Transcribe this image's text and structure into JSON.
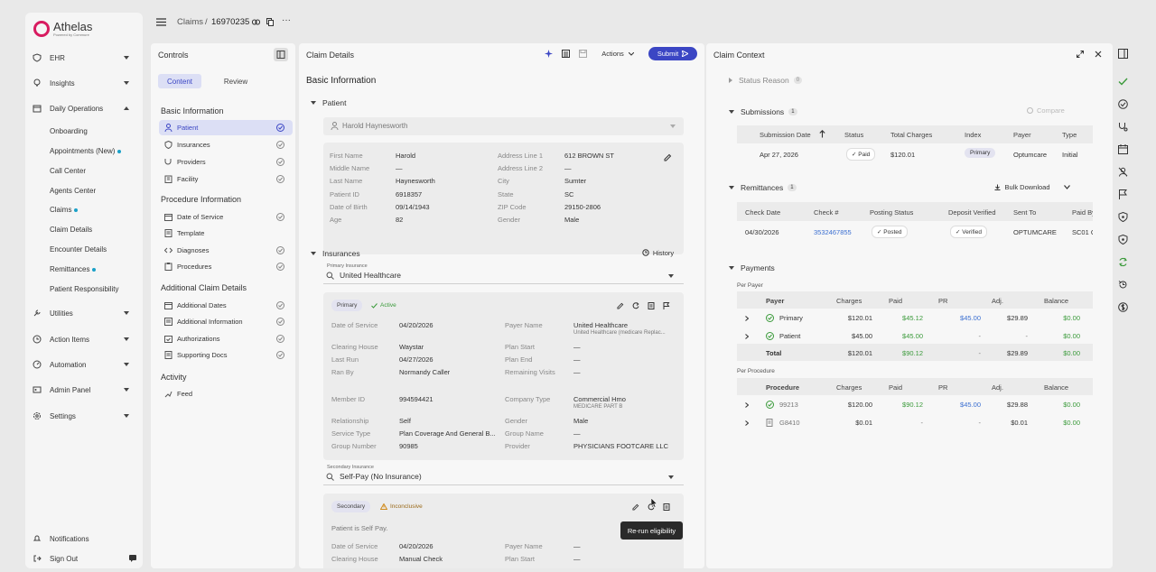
{
  "app": {
    "name": "Athelas",
    "tagline": "Powered by Commure"
  },
  "sidebar": {
    "items": [
      {
        "label": "EHR"
      },
      {
        "label": "Insights"
      },
      {
        "label": "Daily Operations"
      },
      {
        "label": "Utilities"
      },
      {
        "label": "Action Items"
      },
      {
        "label": "Automation"
      },
      {
        "label": "Admin Panel"
      },
      {
        "label": "Settings"
      }
    ],
    "sub_items": [
      {
        "label": "Onboarding"
      },
      {
        "label": "Appointments (New)"
      },
      {
        "label": "Call Center"
      },
      {
        "label": "Agents Center"
      },
      {
        "label": "Claims"
      },
      {
        "label": "Claim Details"
      },
      {
        "label": "Encounter Details"
      },
      {
        "label": "Remittances"
      },
      {
        "label": "Patient Responsibility"
      }
    ],
    "notifications": "Notifications",
    "sign_out": "Sign Out"
  },
  "header": {
    "section": "Claims",
    "separator": "/",
    "claim_id": "16970235",
    "more": "···"
  },
  "controls": {
    "title": "Controls",
    "tabs": [
      "Content",
      "Review"
    ],
    "groups": [
      {
        "heading": "Basic Information",
        "items": [
          "Patient",
          "Insurances",
          "Providers",
          "Facility"
        ]
      },
      {
        "heading": "Procedure Information",
        "items": [
          "Date of Service",
          "Template",
          "Diagnoses",
          "Procedures"
        ]
      },
      {
        "heading": "Additional Claim Details",
        "items": [
          "Additional Dates",
          "Additional Information",
          "Authorizations",
          "Supporting Docs"
        ]
      },
      {
        "heading": "Activity",
        "items": [
          "Feed"
        ]
      }
    ]
  },
  "claim_details": {
    "title": "Claim Details",
    "actions_label": "Actions",
    "submit_label": "Submit",
    "basic_info_title": "Basic Information",
    "patient_section": "Patient",
    "patient_select": "Harold Haynesworth",
    "patient_fields": [
      {
        "label": "First Name",
        "value": "Harold"
      },
      {
        "label": "Middle Name",
        "value": "—"
      },
      {
        "label": "Last Name",
        "value": "Haynesworth"
      },
      {
        "label": "Patient ID",
        "value": "6918357"
      },
      {
        "label": "Date of Birth",
        "value": "09/14/1943"
      },
      {
        "label": "Age",
        "value": "82"
      }
    ],
    "address_fields": [
      {
        "label": "Address Line 1",
        "value": "612 BROWN ST"
      },
      {
        "label": "Address Line 2",
        "value": "—"
      },
      {
        "label": "City",
        "value": "Sumter"
      },
      {
        "label": "State",
        "value": "SC"
      },
      {
        "label": "ZIP Code",
        "value": "29150-2806"
      },
      {
        "label": "Gender",
        "value": "Male"
      }
    ],
    "insurances_section": "Insurances",
    "history_label": "History",
    "primary_insurance_label": "Primary Insurance",
    "primary_insurance_value": "United Healthcare",
    "primary_badge": "Primary",
    "active_badge": "Active",
    "primary_left": [
      {
        "label": "Date of Service",
        "value": "04/20/2026"
      },
      {
        "label": "Clearing House",
        "value": "Waystar"
      },
      {
        "label": "Last Run",
        "value": "04/27/2026"
      },
      {
        "label": "Ran By",
        "value": "Normandy Caller"
      },
      {
        "label": "Member ID",
        "value": "994594421"
      },
      {
        "label": "Relationship",
        "value": "Self"
      },
      {
        "label": "Service Type",
        "value": "Plan Coverage And General B..."
      },
      {
        "label": "Group Number",
        "value": "90985"
      }
    ],
    "primary_right": [
      {
        "label": "Payer Name",
        "value": "United Healthcare",
        "sub": "United Healthcare (medicare Replac..."
      },
      {
        "label": "Plan Start",
        "value": "—"
      },
      {
        "label": "Plan End",
        "value": "—"
      },
      {
        "label": "Remaining Visits",
        "value": "—"
      },
      {
        "label": "Company Type",
        "value": "Commercial Hmo",
        "sub": "MEDICARE PART B"
      },
      {
        "label": "Gender",
        "value": "Male"
      },
      {
        "label": "Group Name",
        "value": "—"
      },
      {
        "label": "Provider",
        "value": "PHYSICIANS FOOTCARE LLC"
      }
    ],
    "secondary_insurance_label": "Secondary Insurance",
    "secondary_insurance_value": "Self-Pay (No Insurance)",
    "secondary_badge": "Secondary",
    "inconclusive_badge": "Inconclusive",
    "self_pay_note": "Patient is Self Pay.",
    "secondary_left": [
      {
        "label": "Date of Service",
        "value": "04/20/2026"
      },
      {
        "label": "Clearing House",
        "value": "Manual Check"
      }
    ],
    "secondary_right": [
      {
        "label": "Payer Name",
        "value": "—"
      },
      {
        "label": "Plan Start",
        "value": "—"
      }
    ],
    "tooltip": "Re-run eligibility"
  },
  "claim_context": {
    "title": "Claim Context",
    "status_reason": {
      "label": "Status Reason",
      "count": "0"
    },
    "submissions": {
      "label": "Submissions",
      "count": "1",
      "compare": "Compare",
      "headers": [
        "Submission Date",
        "Status",
        "Total Charges",
        "Index",
        "Payer",
        "Type"
      ],
      "rows": [
        {
          "date": "Apr 27, 2026",
          "status": "Paid",
          "total": "$120.01",
          "index": "Primary",
          "payer": "Optumcare",
          "type": "Initial"
        }
      ]
    },
    "remittances": {
      "label": "Remittances",
      "count": "1",
      "bulk_download": "Bulk Download",
      "headers": [
        "Check Date",
        "Check #",
        "Posting Status",
        "Deposit Verified",
        "Sent To",
        "Paid By"
      ],
      "rows": [
        {
          "date": "04/30/2026",
          "check": "3532467855",
          "posting": "Posted",
          "deposit": "Verified",
          "sent_to": "OPTUMCARE",
          "paid_by": "SC01 C"
        }
      ]
    },
    "payments": {
      "label": "Payments",
      "per_payer_label": "Per Payer",
      "payer_headers": [
        "Payer",
        "Charges",
        "Paid",
        "PR",
        "Adj.",
        "Balance"
      ],
      "payer_rows": [
        {
          "name": "Primary",
          "charges": "$120.01",
          "paid": "$45.12",
          "pr": "$45.00",
          "adj": "$29.89",
          "balance": "$0.00"
        },
        {
          "name": "Patient",
          "charges": "$45.00",
          "paid": "$45.00",
          "pr": "-",
          "adj": "-",
          "balance": "$0.00"
        }
      ],
      "payer_total": {
        "name": "Total",
        "charges": "$120.01",
        "paid": "$90.12",
        "pr": "-",
        "adj": "$29.89",
        "balance": "$0.00"
      },
      "per_procedure_label": "Per Procedure",
      "procedure_headers": [
        "Procedure",
        "Charges",
        "Paid",
        "PR",
        "Adj.",
        "Balance"
      ],
      "procedure_rows": [
        {
          "name": "99213",
          "charges": "$120.00",
          "paid": "$90.12",
          "pr": "$45.00",
          "adj": "$29.88",
          "balance": "$0.00"
        },
        {
          "name": "G8410",
          "charges": "$0.01",
          "paid": "-",
          "pr": "-",
          "adj": "$0.01",
          "balance": "$0.00"
        }
      ]
    }
  },
  "colors": {
    "accent": "#3b46c4",
    "brand": "#d81b60",
    "paid_green": "#3a9a3a",
    "link_blue": "#3b6fd1"
  }
}
